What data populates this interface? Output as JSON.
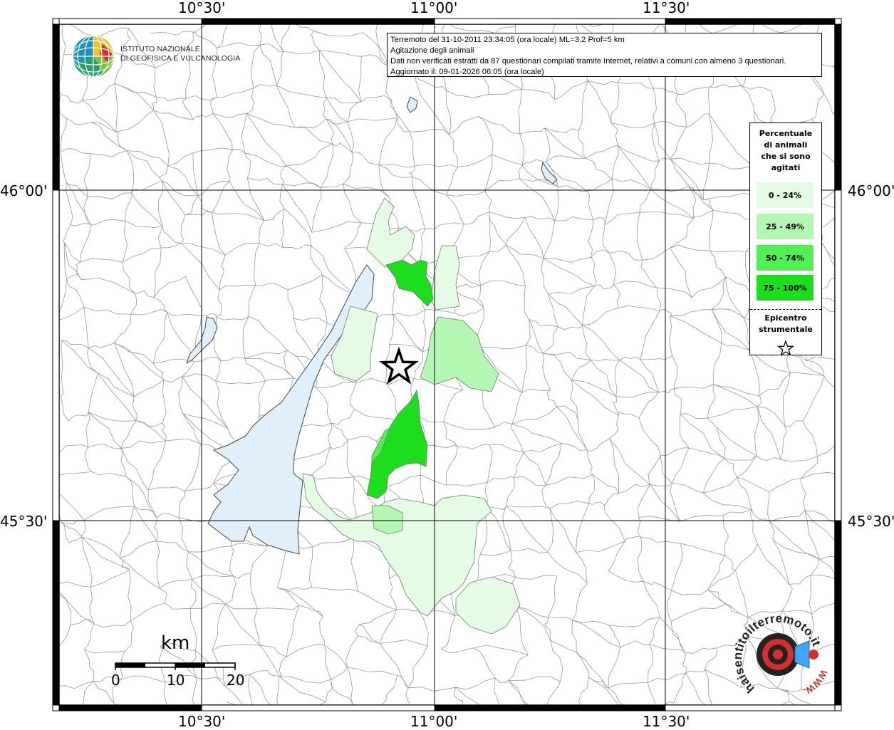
{
  "map": {
    "lon_labels": [
      "10°30'",
      "11°00'",
      "11°30'"
    ],
    "lat_labels": [
      "46°00'",
      "45°30'"
    ],
    "colors": {
      "lake": "#e0effa",
      "class_0_24": "#e6fbe6",
      "class_25_49": "#b4f8b4",
      "class_50_74": "#55ef55",
      "class_75_100": "#1edc1e",
      "border": "#999999"
    }
  },
  "logo": {
    "line1": "ISTITUTO NAZIONALE",
    "line2": "DI GEOFISICA E VULCANOLOGIA",
    "icon": "ingv-globe-icon"
  },
  "info": {
    "line1": "Terremoto del 31-10-2011 23:34:05 (ora locale) ML=3.2 Prof=5 km",
    "line2": "Agitazione degli animali",
    "line3": "Dati non verificati estratti da 87 questionari compilati tramite Internet, relativi a comuni con almeno 3 questionari.",
    "line4": "Aggiornato il: 09-01-2026 06:05 (ora locale)"
  },
  "legend": {
    "title_lines": [
      "Percentuale",
      "di animali",
      "che si sono",
      "agitati"
    ],
    "items": [
      {
        "label": "0 - 24%"
      },
      {
        "label": "25 - 49%"
      },
      {
        "label": "50 - 74%"
      },
      {
        "label": "75 - 100%"
      }
    ],
    "epicenter_lines": [
      "Epicentro",
      "strumentale"
    ],
    "epicenter_icon": "star-icon"
  },
  "scale": {
    "unit": "km",
    "ticks": [
      "0",
      "10",
      "20"
    ]
  },
  "hst_logo": {
    "text_outer": "haisentitoilterremoto.it",
    "text_url": "WWW.",
    "icon": "ear-speaker-icon"
  }
}
